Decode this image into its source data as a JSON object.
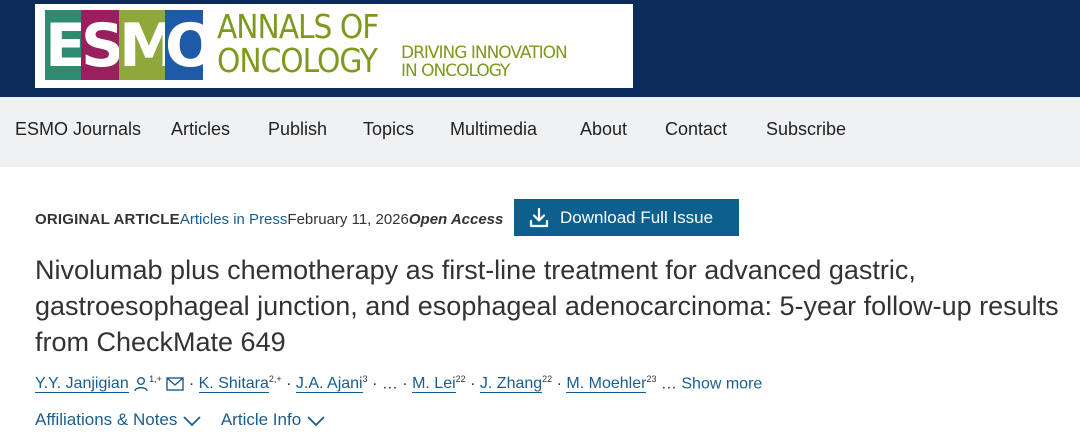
{
  "brand": {
    "logo_letters": [
      "E",
      "S",
      "M",
      "O"
    ],
    "annals_line1": "ANNALS OF",
    "annals_line2": "ONCOLOGY",
    "tagline_line1": "DRIVING INNOVATION",
    "tagline_line2": "IN ONCOLOGY",
    "colors": {
      "band": "#0b2b5b",
      "e": "#2e8b6f",
      "s": "#9a1f5e",
      "m": "#8ea83a",
      "o": "#1f5aa8",
      "text": "#7d9a1f"
    }
  },
  "nav": [
    "ESMO Journals",
    "Articles",
    "Publish",
    "Topics",
    "Multimedia",
    "About",
    "Contact",
    "Subscribe"
  ],
  "meta": {
    "type": "ORIGINAL ARTICLE",
    "section": "Articles in Press",
    "date": "February 11, 2026",
    "access": "Open Access"
  },
  "download": {
    "label": "Download Full Issue",
    "icon": "download-icon"
  },
  "title": "Nivolumab plus chemotherapy as first-line treatment for advanced gastric, gastroesophageal junction, and esophageal adenocarcinoma: 5-year follow-up results from CheckMate 649",
  "authors": [
    {
      "name": "Y.Y. Janjigian",
      "sup": "1,+"
    },
    {
      "name": "K. Shitara",
      "sup": "2,+"
    },
    {
      "name": "J.A. Ajani",
      "sup": "3"
    },
    {
      "name": "M. Lei",
      "sup": "22"
    },
    {
      "name": "J. Zhang",
      "sup": "22"
    },
    {
      "name": "M. Moehler",
      "sup": "23"
    }
  ],
  "separators": {
    "dot": "·",
    "ellipsis": "…"
  },
  "show_more": "Show more",
  "expanders": {
    "affiliations": "Affiliations & Notes",
    "article_info": "Article Info"
  }
}
